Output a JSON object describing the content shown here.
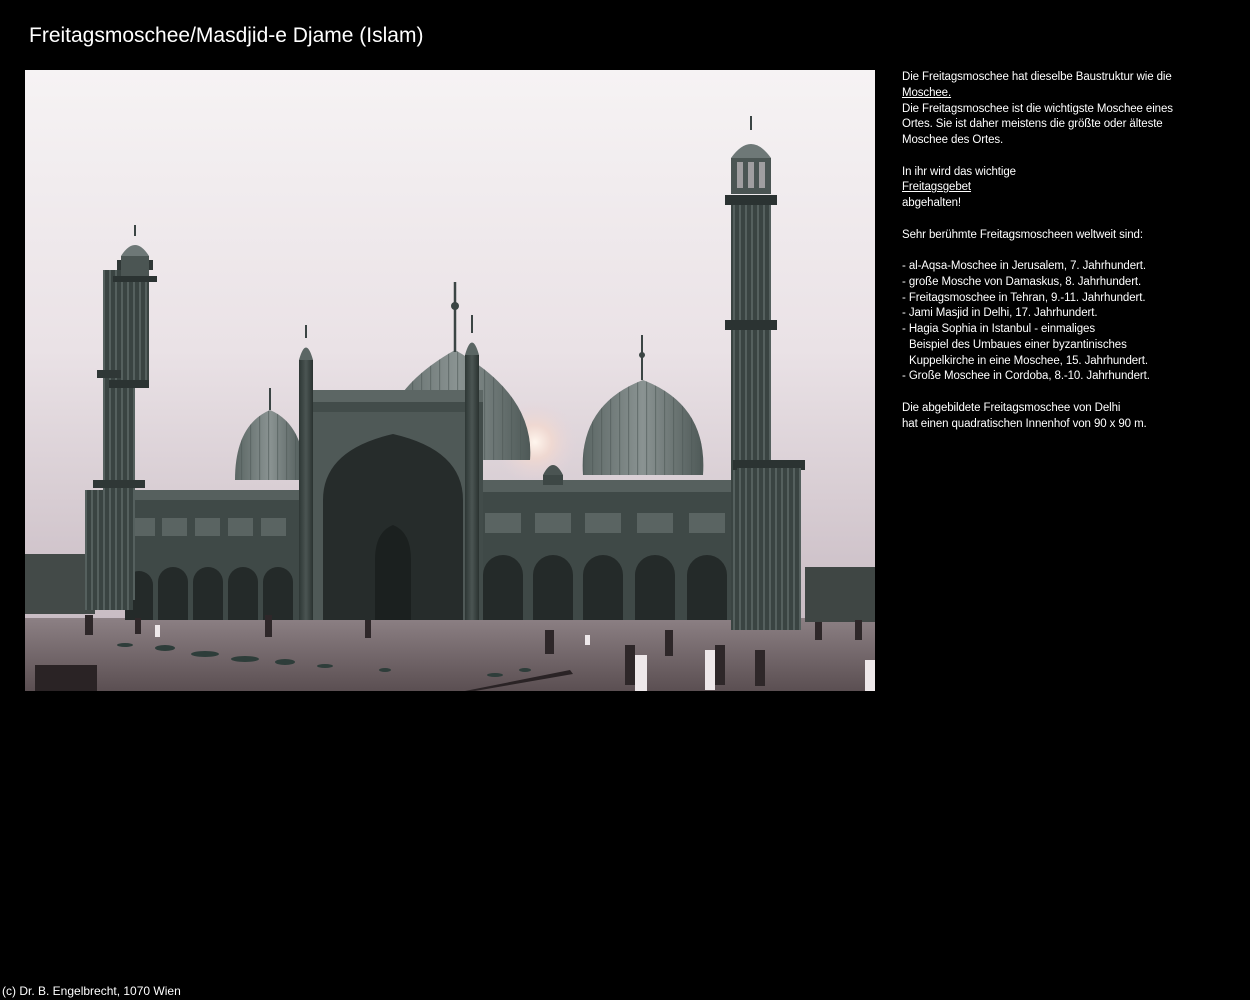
{
  "page": {
    "title": "Freitagsmoschee/Masdjid-e Djame (Islam)"
  },
  "photo": {
    "subject": "mosque-photo"
  },
  "description": {
    "intro_1": "Die Freitagsmoschee hat dieselbe Baustruktur wie die",
    "link_moschee": "Moschee.",
    "intro_2": "Die Freitagsmoschee ist die wichtigste Moschee eines",
    "intro_3": "Ortes. Sie ist daher meistens die größte oder älteste",
    "intro_4": "Moschee des Ortes.",
    "friday_1": "In ihr wird das wichtige",
    "link_freitagsgebet": "Freitagsgebet",
    "friday_2": "abgehalten!",
    "famous_heading": "Sehr berühmte Freitagsmoscheen weltweit sind:",
    "list": [
      "- al-Aqsa-Moschee in Jerusalem, 7. Jahrhundert.",
      "- große Mosche von Damaskus, 8. Jahrhundert.",
      "- Freitagsmoschee in Tehran, 9.-11. Jahrhundert.",
      "- Jami Masjid in Delhi, 17. Jahrhundert.",
      "- Hagia Sophia in Istanbul - einmaliges",
      "Beispiel des Umbaues einer byzantinisches",
      "Kuppelkirche in eine Moschee, 15. Jahrhundert.",
      "- Große Moschee in Cordoba, 8.-10. Jahrhundert."
    ],
    "closing_1": "Die abgebildete Freitagsmoschee von Delhi",
    "closing_2": "hat einen quadratischen Innenhof von 90 x 90 m."
  },
  "footer": {
    "copyright": "(c) Dr. B. Engelbrecht, 1070 Wien"
  },
  "colors": {
    "background": "#000000",
    "text": "#ffffff",
    "sky_top": "#f4f0f2",
    "sky_bottom": "#c9bcc4",
    "stone": "#3d4846",
    "dome": "#6b7473",
    "courtyard": "#4a4244"
  }
}
